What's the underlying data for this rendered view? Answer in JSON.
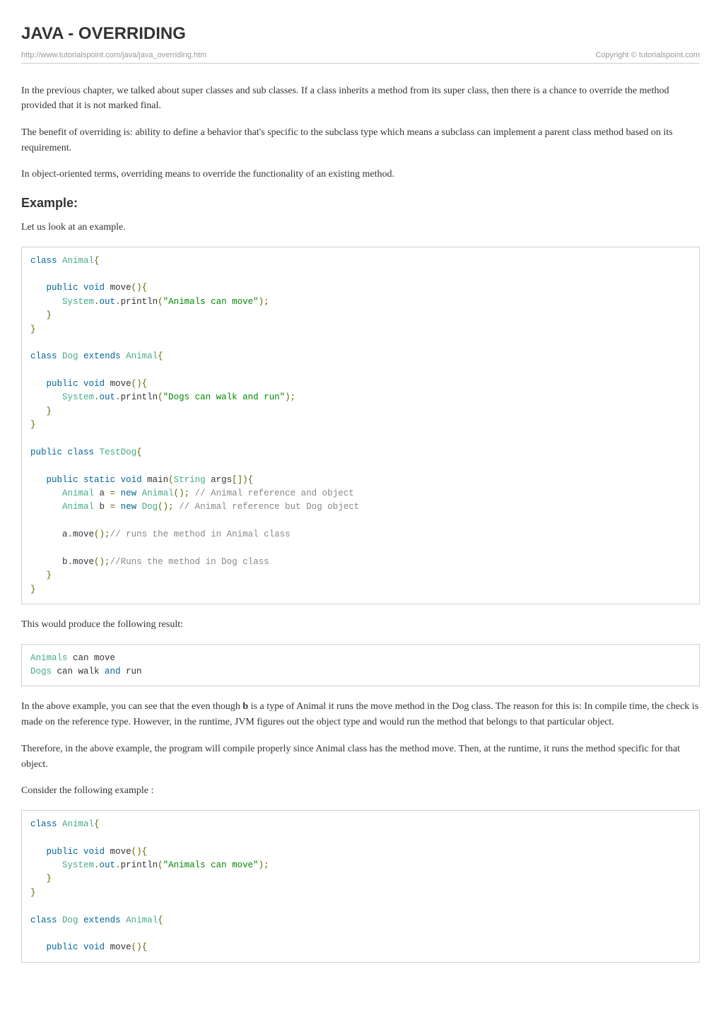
{
  "header": {
    "title": "JAVA - OVERRIDING",
    "url": "http://www.tutorialspoint.com/java/java_overriding.htm",
    "copyright": "Copyright © tutorialspoint.com"
  },
  "intro": {
    "p1": "In the previous chapter, we talked about super classes and sub classes. If a class inherits a method from its super class, then there is a chance to override the method provided that it is not marked final.",
    "p2": "The benefit of overriding is: ability to define a behavior that's specific to the subclass type which means a subclass can implement a parent class method based on its requirement.",
    "p3": "In object-oriented terms, overriding means to override the functionality of an existing method."
  },
  "example": {
    "heading": "Example:",
    "intro": "Let us look at an example.",
    "result_intro": "This would produce the following result:",
    "explain1_pre": "In the above example, you can see that the even though ",
    "explain1_bold": "b",
    "explain1_post": " is a type of Animal it runs the move method in the Dog class. The reason for this is: In compile time, the check is made on the reference type. However, in the runtime, JVM figures out the object type and would run the method that belongs to that particular object.",
    "explain2": "Therefore, in the above example, the program will compile properly since Animal class has the method move. Then, at the runtime, it runs the method specific for that object.",
    "consider": "Consider the following example :"
  },
  "code": {
    "block1": {
      "lines": [
        "class Animal{",
        "",
        "   public void move(){",
        "      System.out.println(\"Animals can move\");",
        "   }",
        "}",
        "",
        "class Dog extends Animal{",
        "",
        "   public void move(){",
        "      System.out.println(\"Dogs can walk and run\");",
        "   }",
        "}",
        "",
        "public class TestDog{",
        "",
        "   public static void main(String args[]){",
        "      Animal a = new Animal(); // Animal reference and object",
        "      Animal b = new Dog(); // Animal reference but Dog object",
        "",
        "      a.move();// runs the method in Animal class",
        "",
        "      b.move();//Runs the method in Dog class",
        "   }",
        "}"
      ]
    },
    "output1": {
      "lines": [
        "Animals can move",
        "Dogs can walk and run"
      ]
    },
    "block2": {
      "lines": [
        "class Animal{",
        "",
        "   public void move(){",
        "      System.out.println(\"Animals can move\");",
        "   }",
        "}",
        "",
        "class Dog extends Animal{",
        "",
        "   public void move(){"
      ]
    }
  }
}
